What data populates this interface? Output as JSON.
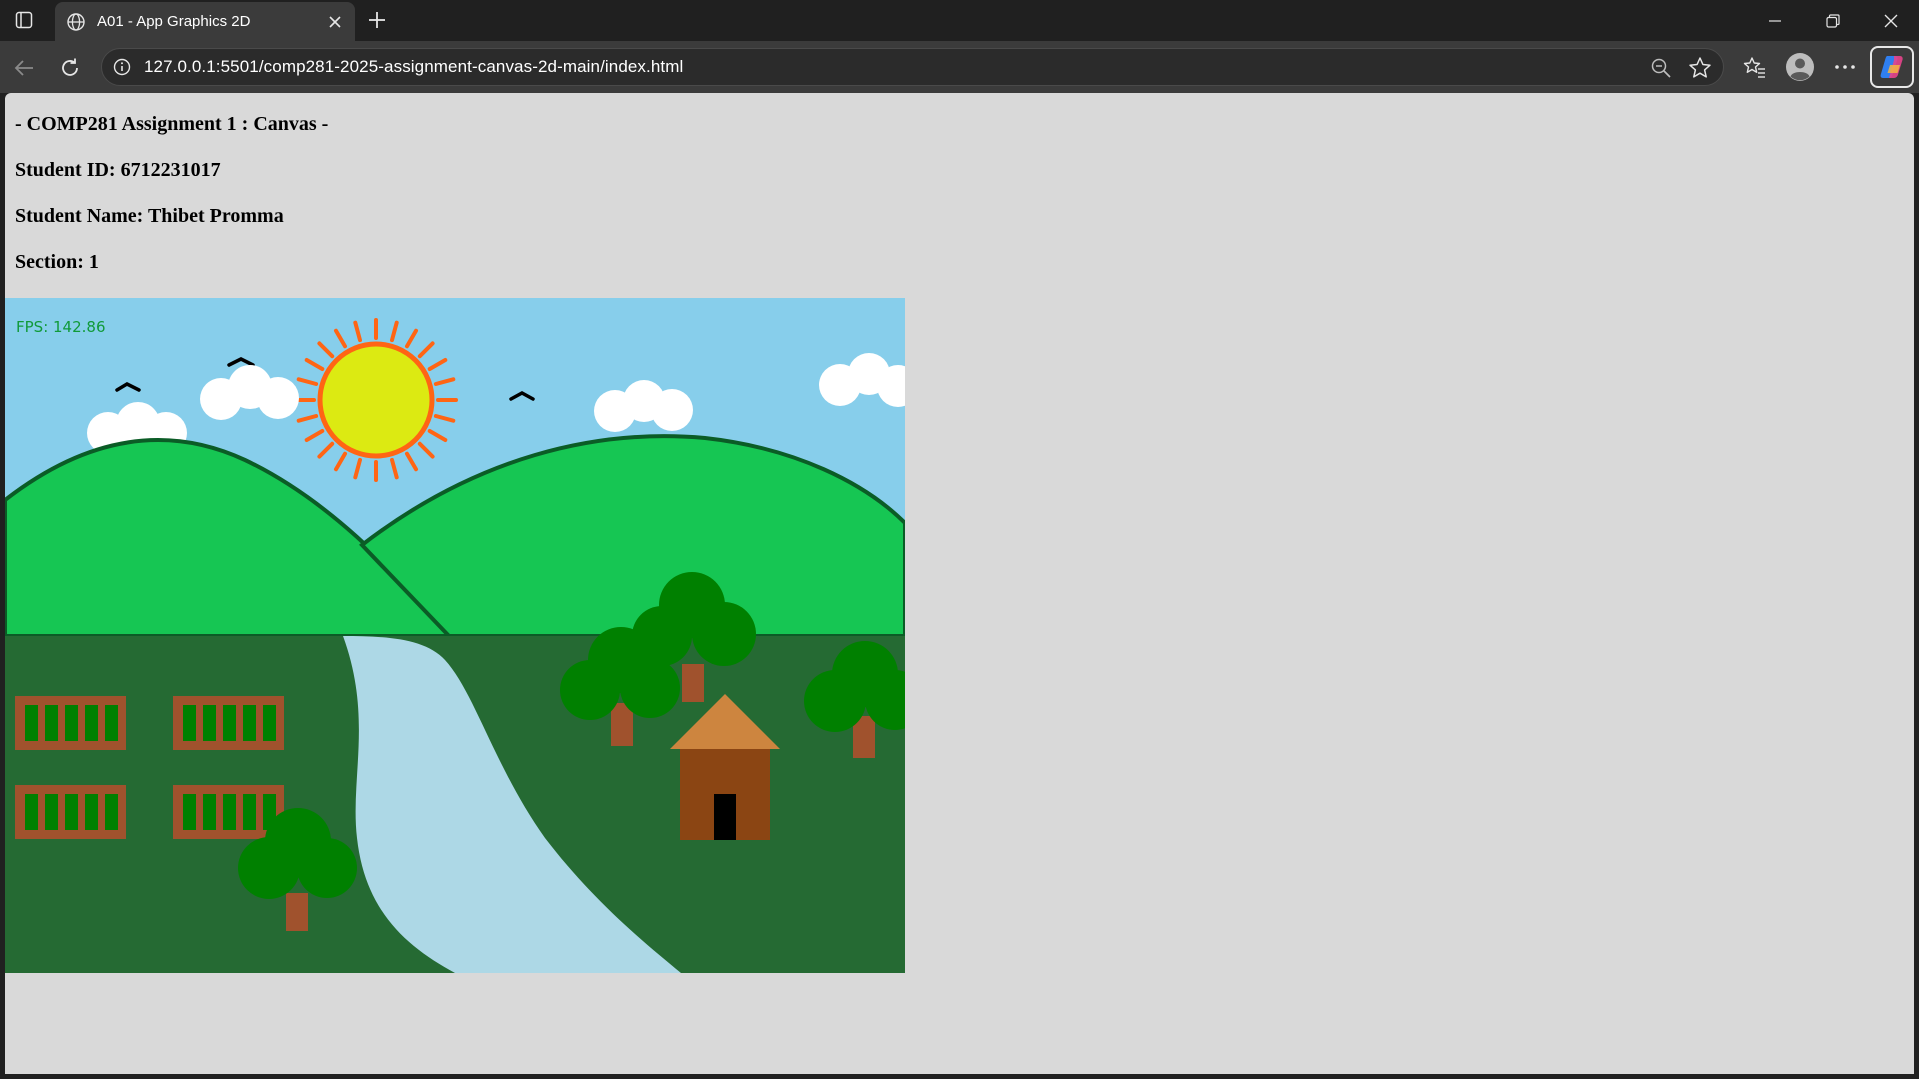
{
  "browser": {
    "tab_title": "A01 - App Graphics 2D",
    "url": "127.0.0.1:5501/comp281-2025-assignment-canvas-2d-main/index.html",
    "icons": [
      "tab-actions-icon",
      "globe-icon",
      "close-icon",
      "plus-icon",
      "minimize-icon",
      "restore-icon",
      "window-close-icon",
      "back-arrow-icon",
      "reload-icon",
      "info-icon",
      "zoom-out-icon",
      "star-icon",
      "favorites-icon",
      "profile-icon",
      "more-icon",
      "copilot-icon"
    ]
  },
  "page": {
    "headings": [
      "- COMP281 Assignment 1 : Canvas -",
      "Student ID: 6712231017",
      "Student Name: Thibet Promma",
      "Section: 1"
    ],
    "canvas": {
      "fps_text": "FPS: 142.86",
      "colors": {
        "sky": "#87ceeb",
        "hill": "#16c653",
        "hill_outline": "#0b5c26",
        "ground": "#256a33",
        "river": "#add8e6",
        "sun": "#dcea12",
        "sun_ray": "#ff6514",
        "cloud": "#ffffff",
        "tree_foliage": "#008000",
        "tree_trunk": "#a0522d",
        "house_wall": "#8b4513",
        "house_roof": "#cd853f",
        "door": "#000000",
        "field_frame": "#a0522d",
        "field_crop": "#008000",
        "bird": "#000000",
        "fps_text": "#109a39"
      }
    }
  }
}
